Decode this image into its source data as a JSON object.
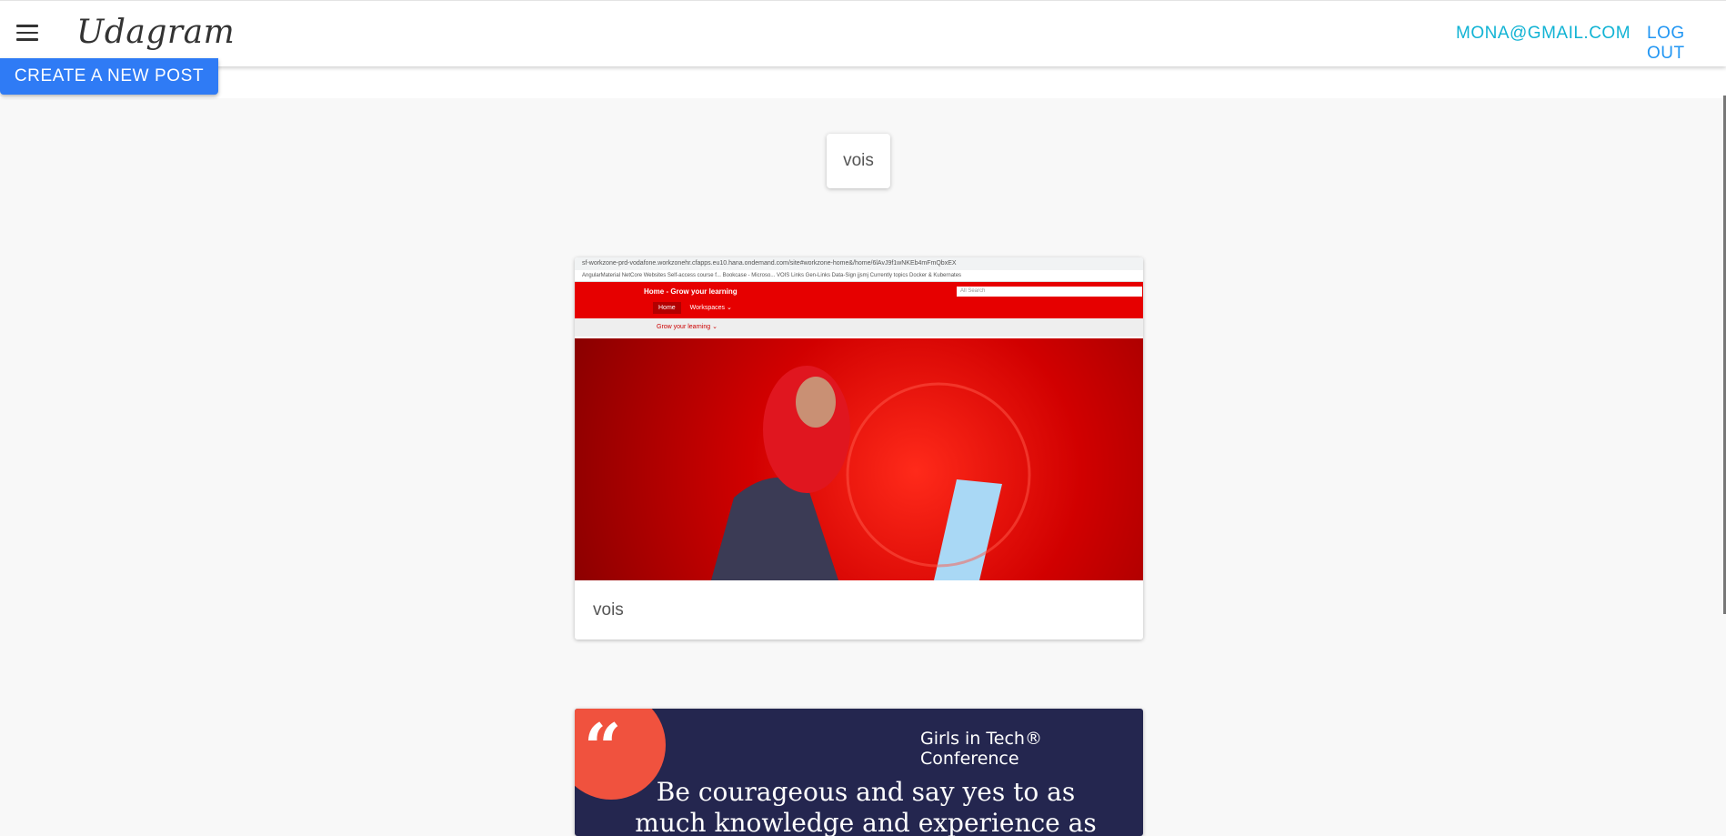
{
  "header": {
    "brand": "Udagram",
    "email": "MONA@GMAIL.COM",
    "logout": "LOG OUT"
  },
  "actions": {
    "create_post": "CREATE A NEW POST"
  },
  "filter_chip": "vois",
  "posts": [
    {
      "caption": "vois",
      "image": {
        "url_text": "sf-workzone-prd-vodafone.workzonehr.cfapps.eu10.hana.ondemand.com/site#workzone-home&/home/6lAvJ9f1wNKEb4mFmQbxEX",
        "bookmarks": "AngularMaterial   NetCore   Websites   Self-access course f...   Bookcase - Microso...   VOIS Links   Gen-Links   Data-Sign   jjsmj   Currently topics   Docker & Kubernates",
        "title": "Home - Grow your learning",
        "search_scope": "All",
        "search_placeholder": "Search",
        "tab_home": "Home",
        "tab_workspaces": "Workspaces ⌄",
        "subnav": "Grow your learning ⌄"
      }
    },
    {
      "image": {
        "badge": "Girls in Tech® Conference",
        "quote": "Be courageous and say yes to as much knowledge and experience as"
      }
    }
  ],
  "colors": {
    "primary": "#2f7bf5",
    "link": "#11b3d4",
    "logout": "#2196f3"
  }
}
